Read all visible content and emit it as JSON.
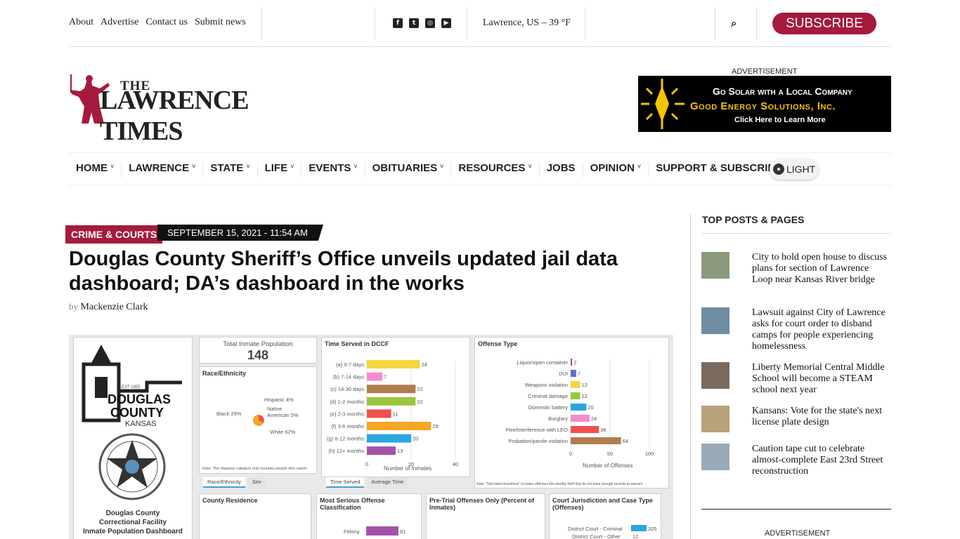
{
  "topbar": {
    "links": [
      "About",
      "Advertise",
      "Contact us",
      "Submit news"
    ],
    "social_icons": [
      "facebook-icon",
      "twitter-icon",
      "instagram-icon",
      "youtube-icon"
    ],
    "weather": "Lawrence, US – 39 °F",
    "subscribe_label": "SUBSCRIBE"
  },
  "logo": {
    "line1": "THE",
    "line2": "LAWRENCE TIMES"
  },
  "ad": {
    "label": "ADVERTISEMENT",
    "line1": "Go Solar with a Local Company",
    "line2": "Good Energy Solutions, Inc.",
    "line3": "Click Here to Learn More"
  },
  "nav": {
    "items": [
      {
        "label": "HOME",
        "dropdown": true
      },
      {
        "label": "LAWRENCE",
        "dropdown": true
      },
      {
        "label": "STATE",
        "dropdown": true
      },
      {
        "label": "LIFE",
        "dropdown": true
      },
      {
        "label": "EVENTS",
        "dropdown": true
      },
      {
        "label": "OBITUARIES",
        "dropdown": true
      },
      {
        "label": "RESOURCES",
        "dropdown": true
      },
      {
        "label": "JOBS",
        "dropdown": false
      },
      {
        "label": "OPINION",
        "dropdown": true
      },
      {
        "label": "SUPPORT & SUBSCRIBE",
        "dropdown": true
      }
    ],
    "theme_toggle": "LIGHT"
  },
  "article": {
    "category": "CRIME & COURTS",
    "date": "SEPTEMBER 15, 2021 - 11:54 AM",
    "title": "Douglas County Sheriff’s Office unveils updated jail data dashboard; DA’s dashboard in the works",
    "by": "by",
    "author": "Mackenzie Clark"
  },
  "dashboard": {
    "logo_title1": "DOUGLAS",
    "logo_title2": "COUNTY",
    "logo_sub": "KANSAS",
    "logo_est": "EST 1855",
    "caption": [
      "Douglas County",
      "Correctional Facility",
      "Inmate Population Dashboard"
    ],
    "total_label": "Total Inmate Population",
    "total_value": "148",
    "race_title": "Race/Ethnicity",
    "race_labels": [
      "Hispanic 4%",
      "Native American 5%",
      "White 62%",
      "Black 29%"
    ],
    "race_note": "Note: The Hispanic category only includes people who report",
    "race_tabs": [
      "Race/Ethnicity",
      "Sex"
    ],
    "time_title": "Time Served in DCCF",
    "time_xlabel": "Number of Inmates",
    "time_tabs": [
      "Time Served",
      "Average Time"
    ],
    "offense_title": "Offense Type",
    "offense_xlabel": "Number of Offenses",
    "offense_note": "Note: \"Not listed elsewhere\" includes offenses like identity theft that do not have enough records to warrant",
    "residence_title": "County Residence",
    "serious_title": "Most Serious Offense Classification",
    "serious_first": "Felony",
    "serious_value": "81",
    "pretrial_title": "Pre-Trial Offenses Only (Percent of Inmates)",
    "court_title": "Court Jurisdiction and Case Type (Offenses)",
    "court_rows": [
      {
        "label": "District Court - Criminal",
        "value": "325"
      },
      {
        "label": "District Court - Other",
        "value": "12"
      }
    ]
  },
  "chart_data": [
    {
      "type": "bar",
      "title": "Time Served in DCCF",
      "xlabel": "Number of Inmates",
      "categories": [
        "(a) 0-7 days",
        "(b) 7-14 days",
        "(c) 14-30 days",
        "(d) 1-2 months",
        "(e) 2-3 months",
        "(f) 3-6 months",
        "(g) 6-12 months",
        "(h) 12+ months"
      ],
      "values": [
        24,
        7,
        22,
        22,
        11,
        29,
        20,
        13
      ],
      "xlim": [
        0,
        40
      ],
      "xticks": [
        0,
        20,
        40
      ],
      "colors": [
        "#f4d742",
        "#f58ad0",
        "#b07e4f",
        "#9bc53d",
        "#ef4f4f",
        "#f5a623",
        "#2ba6de",
        "#a452a8"
      ]
    },
    {
      "type": "bar",
      "title": "Offense Type",
      "xlabel": "Number of Offenses",
      "categories": [
        "Liquor/open container",
        "DUI",
        "Weapons violation",
        "Criminal damage",
        "Domestic battery",
        "Burglary",
        "Flee/interference with LEO",
        "Probation/parole violation"
      ],
      "values": [
        2,
        7,
        12,
        12,
        20,
        24,
        36,
        64
      ],
      "xlim": [
        0,
        100
      ],
      "xticks": [
        0,
        50,
        100
      ],
      "colors": [
        "#a452a8",
        "#5a6fd1",
        "#f4d742",
        "#9bc53d",
        "#2ba6de",
        "#f58ad0",
        "#ef4f4f",
        "#b07e4f"
      ]
    }
  ],
  "sidebar": {
    "title": "TOP POSTS & PAGES",
    "posts": [
      {
        "title": "City to hold open house to discuss plans for section of Lawrence Loop near Kansas River bridge",
        "thumb": "#8a9a7a"
      },
      {
        "title": "Lawsuit against City of Lawrence asks for court order to disband camps for people experiencing homelessness",
        "thumb": "#6f8da3"
      },
      {
        "title": "Liberty Memorial Central Middle School will become a STEAM school next year",
        "thumb": "#7a6a5e"
      },
      {
        "title": "Kansans: Vote for the state's next license plate design",
        "thumb": "#b8a27c"
      },
      {
        "title": "Caution tape cut to celebrate almost-complete East 23rd Street reconstruction",
        "thumb": "#9aaab8"
      }
    ],
    "ad_label": "ADVERTISEMENT"
  }
}
